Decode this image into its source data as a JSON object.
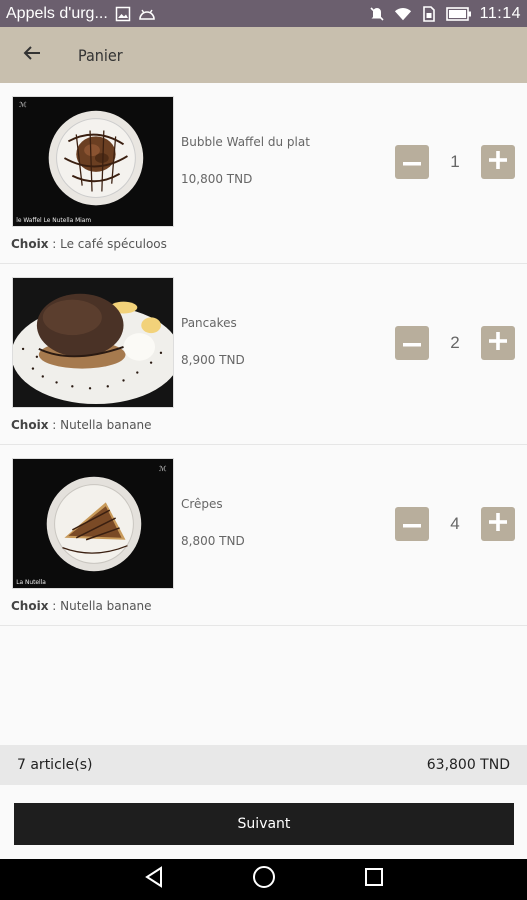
{
  "status_bar": {
    "notification_text": "Appels d'urg...",
    "time": "11:14",
    "icons": [
      "image-icon",
      "android-icon",
      "mute-icon",
      "wifi-icon",
      "sim-icon",
      "battery-icon"
    ]
  },
  "app_bar": {
    "title": "Panier",
    "back_icon": "arrow-left-icon"
  },
  "cart": {
    "choice_label": "Choix",
    "items": [
      {
        "name": "Bubble Waffel du plat",
        "price": "10,800 TND",
        "quantity": "1",
        "choice": " : Le café spéculoos",
        "thumb_caption": "le Waffel Le Nutella Miam"
      },
      {
        "name": "Pancakes",
        "price": "8,900 TND",
        "quantity": "2",
        "choice": " : Nutella banane"
      },
      {
        "name": "Crêpes",
        "price": "8,800 TND",
        "quantity": "4",
        "choice": " : Nutella banane",
        "thumb_caption": "La Nutella"
      }
    ]
  },
  "summary": {
    "count": "7 article(s)",
    "total": "63,800 TND"
  },
  "next_button": {
    "label": "Suivant"
  },
  "colors": {
    "status_bar": "#6b5f6e",
    "app_bar": "#c8bfae",
    "qty_button": "#b8ae9c",
    "next_button": "#1e1e1e"
  }
}
